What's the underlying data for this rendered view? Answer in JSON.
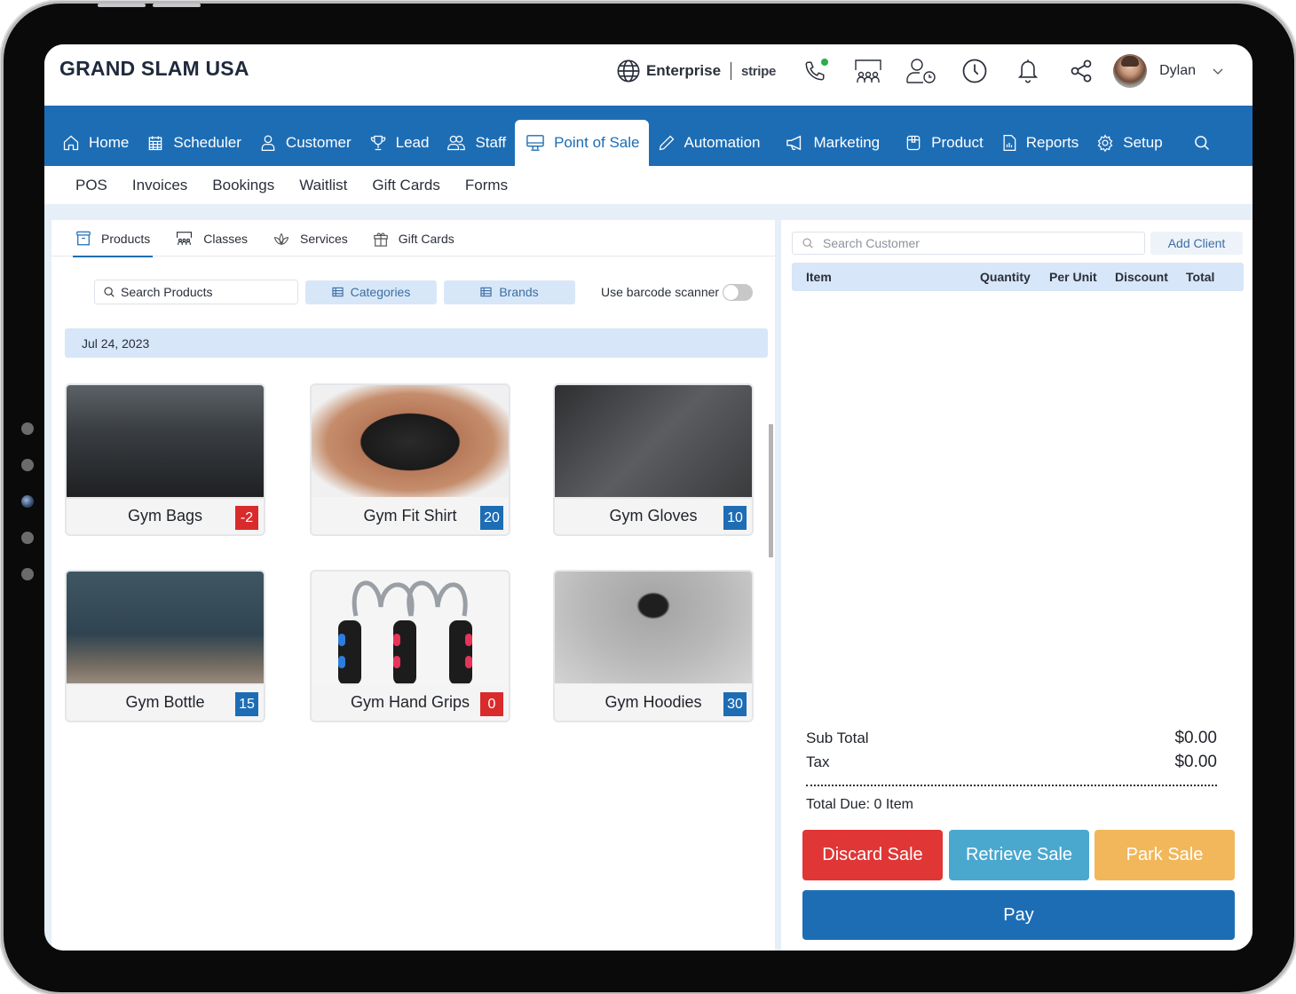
{
  "header": {
    "brand": "GRAND SLAM USA",
    "enterprise_label": "Enterprise",
    "payment_provider": "stripe",
    "user_name": "Dylan",
    "phone_status_color": "#27ae4b",
    "icons": [
      "globe-icon",
      "phone-icon",
      "classroom-icon",
      "user-clock-icon",
      "clock-icon",
      "bell-icon",
      "share-icon",
      "chevron-down-icon"
    ]
  },
  "main_nav": {
    "items": [
      {
        "label": "Home",
        "icon": "home-icon"
      },
      {
        "label": "Scheduler",
        "icon": "calendar-icon"
      },
      {
        "label": "Customer",
        "icon": "user-icon"
      },
      {
        "label": "Lead",
        "icon": "trophy-icon"
      },
      {
        "label": "Staff",
        "icon": "users-icon"
      },
      {
        "label": "Point of Sale",
        "icon": "monitor-icon",
        "active": true
      },
      {
        "label": "Automation",
        "icon": "pencil-icon"
      },
      {
        "label": "Marketing",
        "icon": "megaphone-icon"
      },
      {
        "label": "Product",
        "icon": "box-icon"
      },
      {
        "label": "Reports",
        "icon": "report-icon"
      },
      {
        "label": "Setup",
        "icon": "gear-icon"
      }
    ],
    "accent_color": "#1d6db5"
  },
  "sub_nav": {
    "items": [
      "POS",
      "Invoices",
      "Bookings",
      "Waitlist",
      "Gift Cards",
      "Forms"
    ]
  },
  "product_tabs": {
    "items": [
      {
        "label": "Products",
        "icon": "archive-icon",
        "active": true
      },
      {
        "label": "Classes",
        "icon": "classroom-icon"
      },
      {
        "label": "Services",
        "icon": "lotus-icon"
      },
      {
        "label": "Gift Cards",
        "icon": "gift-icon"
      }
    ]
  },
  "toolbar": {
    "search_placeholder": "Search Products",
    "categories_label": "Categories",
    "brands_label": "Brands",
    "barcode_label": "Use barcode scanner",
    "barcode_enabled": false
  },
  "date_label": "Jul 24, 2023",
  "products": [
    {
      "name": "Gym Bags",
      "stock": "-2",
      "badge_color": "#d92b2b"
    },
    {
      "name": "Gym Fit Shirt",
      "stock": "20",
      "badge_color": "#1d6db5"
    },
    {
      "name": "Gym Gloves",
      "stock": "10",
      "badge_color": "#1d6db5"
    },
    {
      "name": "Gym Bottle",
      "stock": "15",
      "badge_color": "#1d6db5"
    },
    {
      "name": "Gym Hand Grips",
      "stock": "0",
      "badge_color": "#d92b2b"
    },
    {
      "name": "Gym Hoodies",
      "stock": "30",
      "badge_color": "#1d6db5"
    }
  ],
  "cart": {
    "customer_search_placeholder": "Search Customer",
    "add_client_label": "Add Client",
    "columns": [
      "Item",
      "Quantity",
      "Per Unit",
      "Discount",
      "Total"
    ],
    "rows": [],
    "sub_total_label": "Sub Total",
    "sub_total": "$0.00",
    "tax_label": "Tax",
    "tax": "$0.00",
    "total_due": "Total Due: 0 Item"
  },
  "actions": {
    "discard": {
      "label": "Discard Sale",
      "color": "#e03636"
    },
    "retrieve": {
      "label": "Retrieve Sale",
      "color": "#4aa8cf"
    },
    "park": {
      "label": "Park Sale",
      "color": "#f2b75a"
    },
    "pay": {
      "label": "Pay",
      "color": "#1d6db5"
    }
  }
}
